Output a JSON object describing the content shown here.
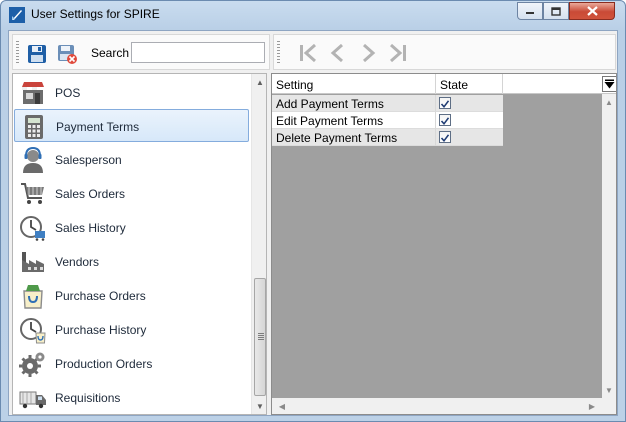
{
  "window": {
    "title": "User Settings for SPIRE",
    "minimize_label": "▭",
    "maximize_label": "▢",
    "close_label": "✕"
  },
  "toolbar": {
    "save_icon": "save-icon",
    "discard_icon": "save-discard-icon",
    "search_label": "Search",
    "search_value": "",
    "search_placeholder": ""
  },
  "navigation": {
    "first_icon": "first-record-icon",
    "prev_icon": "previous-record-icon",
    "next_icon": "next-record-icon",
    "last_icon": "last-record-icon"
  },
  "modules": [
    {
      "label": "POS",
      "icon": "pos-store-icon"
    },
    {
      "label": "Payment Terms",
      "icon": "calculator-icon",
      "selected": true
    },
    {
      "label": "Salesperson",
      "icon": "headset-person-icon"
    },
    {
      "label": "Sales Orders",
      "icon": "shopping-cart-icon"
    },
    {
      "label": "Sales History",
      "icon": "clock-cart-icon"
    },
    {
      "label": "Vendors",
      "icon": "factory-icon"
    },
    {
      "label": "Purchase Orders",
      "icon": "shopping-bag-icon"
    },
    {
      "label": "Purchase History",
      "icon": "clock-bag-icon"
    },
    {
      "label": "Production Orders",
      "icon": "gears-icon"
    },
    {
      "label": "Requisitions",
      "icon": "truck-icon"
    }
  ],
  "grid": {
    "columns": [
      "Setting",
      "State"
    ],
    "rows": [
      {
        "setting": "Add Payment Terms",
        "state": true
      },
      {
        "setting": "Edit Payment Terms",
        "state": true
      },
      {
        "setting": "Delete Payment Terms",
        "state": true
      }
    ],
    "filter_icon": "column-chooser-icon"
  },
  "colors": {
    "title_bar": "#bcd1e7",
    "selected_item": "#d7e8f9",
    "grid_empty_area": "#a0a0a0",
    "close_button": "#c94a36"
  }
}
